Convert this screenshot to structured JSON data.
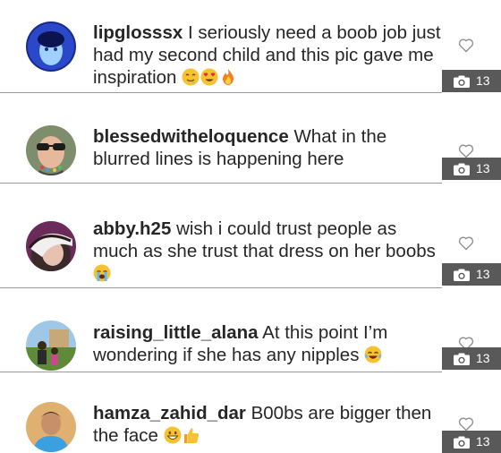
{
  "comments": [
    {
      "username": "lipglosssx",
      "text": "I seriously need a boob job just had my second child and this pic gave me inspiration",
      "emojis": [
        "drooling-face",
        "heart-eyes-face",
        "fire"
      ],
      "photo_count": "13"
    },
    {
      "username": "blessedwitheloquence",
      "text": "What in the blurred lines is happening here",
      "emojis": [],
      "photo_count": "13"
    },
    {
      "username": "abby.h25",
      "text": "wish i could trust people as much as she trust that dress on her boobs",
      "emojis": [
        "crying-face"
      ],
      "photo_count": "13"
    },
    {
      "username": "raising_little_alana",
      "text": "At this point I’m wondering if she has any nipples",
      "emojis": [
        "tears-of-joy-face"
      ],
      "photo_count": "13"
    },
    {
      "username": "hamza_zahid_dar",
      "text": "B00bs are bigger then the face",
      "emojis": [
        "grinning-face",
        "thumbs-up"
      ],
      "photo_count": "13"
    }
  ],
  "colors": {
    "text": "#262626",
    "badge_background": "#595959",
    "divider": "#9a9a9a",
    "heart_outline": "#8e8e8e"
  }
}
